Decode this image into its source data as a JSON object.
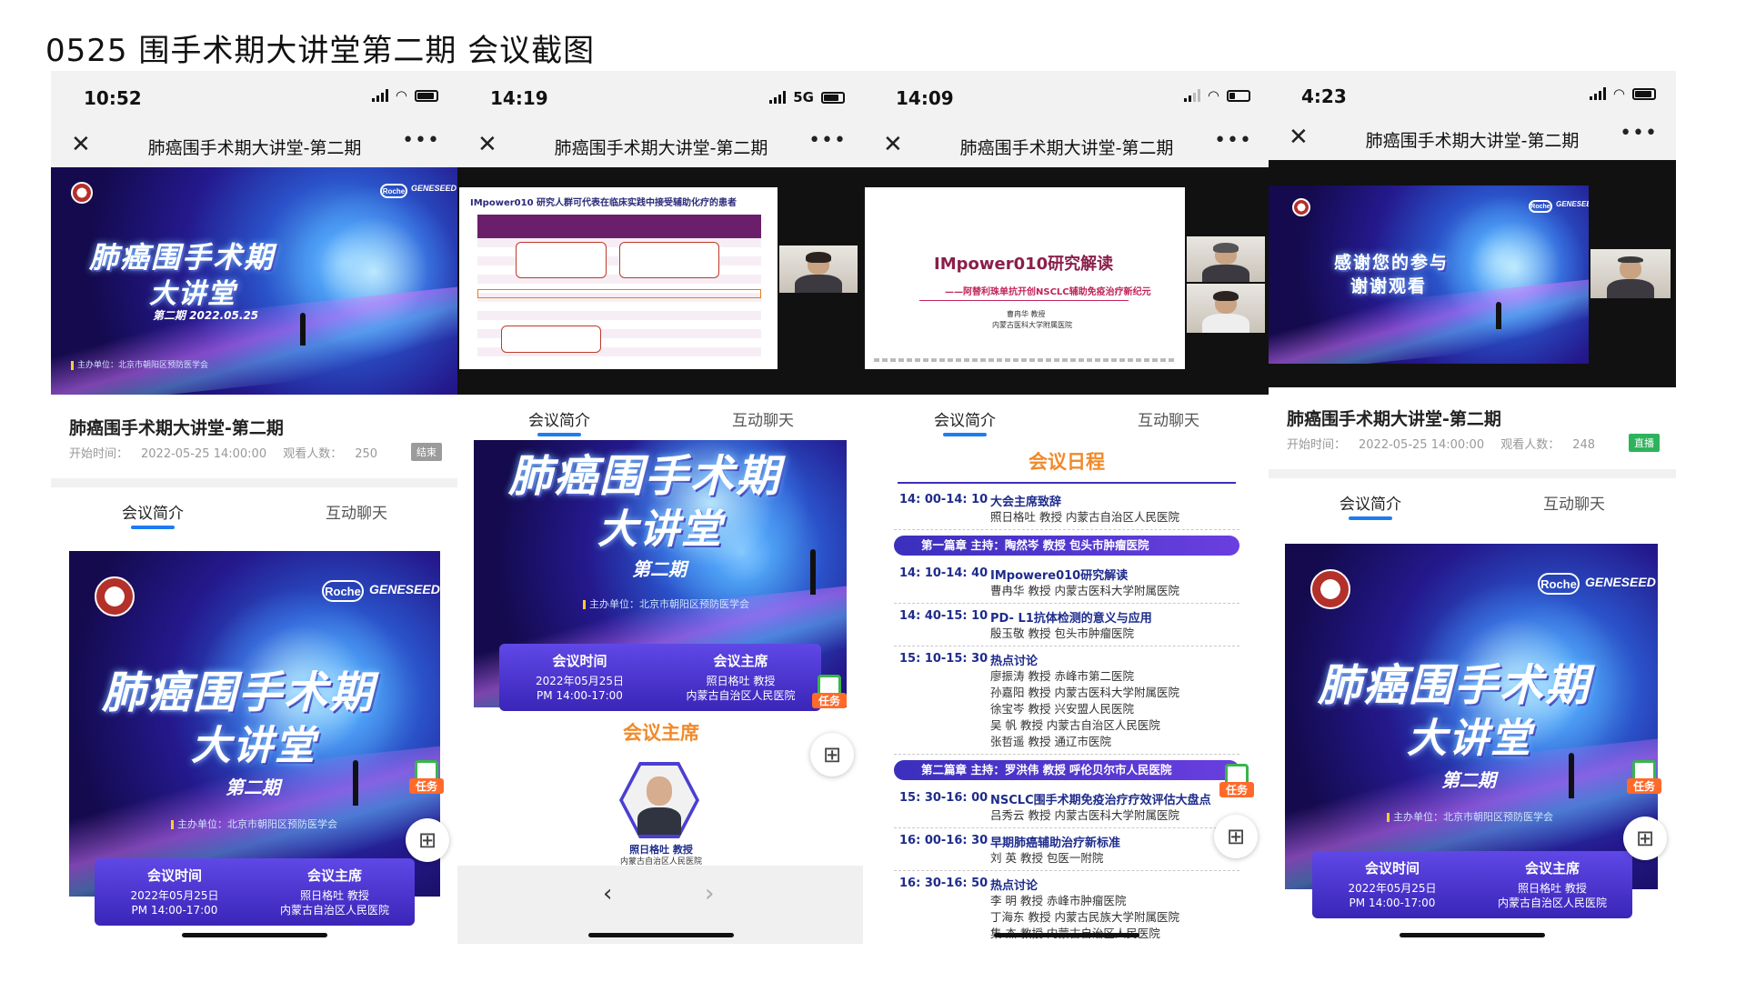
{
  "page_title": "0525 围手术期大讲堂第二期 会议截图",
  "common": {
    "nav_title": "肺癌围手术期大讲堂-第二期",
    "meeting_title": "肺癌围手术期大讲堂-第二期",
    "tab_intro": "会议简介",
    "tab_chat": "互动聊天",
    "task_label": "任务",
    "poster_title_1": "肺癌围手术期",
    "poster_title_2": "大讲堂",
    "poster_issue": "第二期",
    "poster_host": "主办单位：北京市朝阳区预防医学会",
    "roche": "Roche",
    "genesee": "GENESEED",
    "info_time_label": "会议时间",
    "info_time_value_1": "2022年05月25日",
    "info_time_value_2": "PM 14:00-17:00",
    "info_chair_label": "会议主席",
    "info_chair_value_1": "照日格吐 教授",
    "info_chair_value_2": "内蒙古自治区人民医院"
  },
  "phones": [
    {
      "time": "10:52",
      "video_date": "第二期 2022.05.25",
      "start_label": "开始时间：",
      "start_time": "2022-05-25 14:00:00",
      "viewers_label": "观看人数：",
      "viewers": "250",
      "status": "结束"
    },
    {
      "time": "14:19",
      "network": "5G",
      "slide_heading": "IMpower010 研究人群可代表在临床实践中接受辅助化疗的患者",
      "chair_heading": "会议主席",
      "chair_name": "照日格吐 教授",
      "chair_org": "内蒙古自治区人民医院"
    },
    {
      "time": "14:09",
      "nav_title": "肺癌围手术期大讲堂-第二期",
      "slide_title": "IMpower010研究解读",
      "slide_subtitle": "——阿替利珠单抗开创NSCLC辅助免疫治疗新纪元",
      "slide_speaker": "曹冉华 教授",
      "slide_org": "内蒙古医科大学附属医院",
      "schedule_heading": "会议日程",
      "schedule": [
        {
          "time": "14: 00-14: 10",
          "topic": "大会主席致辞",
          "speakers": [
            "照日格吐  教授  内蒙古自治区人民医院"
          ]
        },
        {
          "chapter": "第一篇章    主持：陶然岑 教授 包头市肿瘤医院"
        },
        {
          "time": "14: 10-14: 40",
          "topic": "IMpowere010研究解读",
          "speakers": [
            "曹冉华  教授  内蒙古医科大学附属医院"
          ]
        },
        {
          "time": "14: 40-15: 10",
          "topic": "PD- L1抗体检测的意义与应用",
          "speakers": [
            "殷玉敬  教授  包头市肿瘤医院"
          ]
        },
        {
          "time": "15: 10-15: 30",
          "topic": "热点讨论",
          "speakers": [
            "廖振涛  教授  赤峰市第二医院",
            "孙嘉阳  教授  内蒙古医科大学附属医院",
            "徐宝岑  教授  兴安盟人民医院",
            "吴    帆  教授  内蒙古自治区人民医院",
            "张哲遥  教授  通辽市医院"
          ]
        },
        {
          "chapter": "第二篇章    主持：罗洪伟 教授 呼伦贝尔市人民医院"
        },
        {
          "time": "15: 30-16: 00",
          "topic": "NSCLC围手术期免疫治疗疗效评估大盘点",
          "speakers": [
            "吕秀云  教授  内蒙古医科大学附属医院"
          ]
        },
        {
          "time": "16: 00-16: 30",
          "topic": "早期肺癌辅助治疗新标准",
          "speakers": [
            "刘    英  教授  包医一附院"
          ]
        },
        {
          "time": "16: 30-16: 50",
          "topic": "热点讨论",
          "speakers": [
            "李    明  教授  赤峰市肿瘤医院",
            "丁海东  教授  内蒙古民族大学附属医院",
            "集    杰  教授  内蒙古自治区人民医院"
          ]
        }
      ]
    },
    {
      "time": "4:23",
      "video_thanks_1": "感谢您的参与",
      "video_thanks_2": "谢谢观看",
      "start_label": "开始时间：",
      "start_time": "2022-05-25 14:00:00",
      "viewers_label": "观看人数：",
      "viewers": "248",
      "status": "直播"
    }
  ]
}
